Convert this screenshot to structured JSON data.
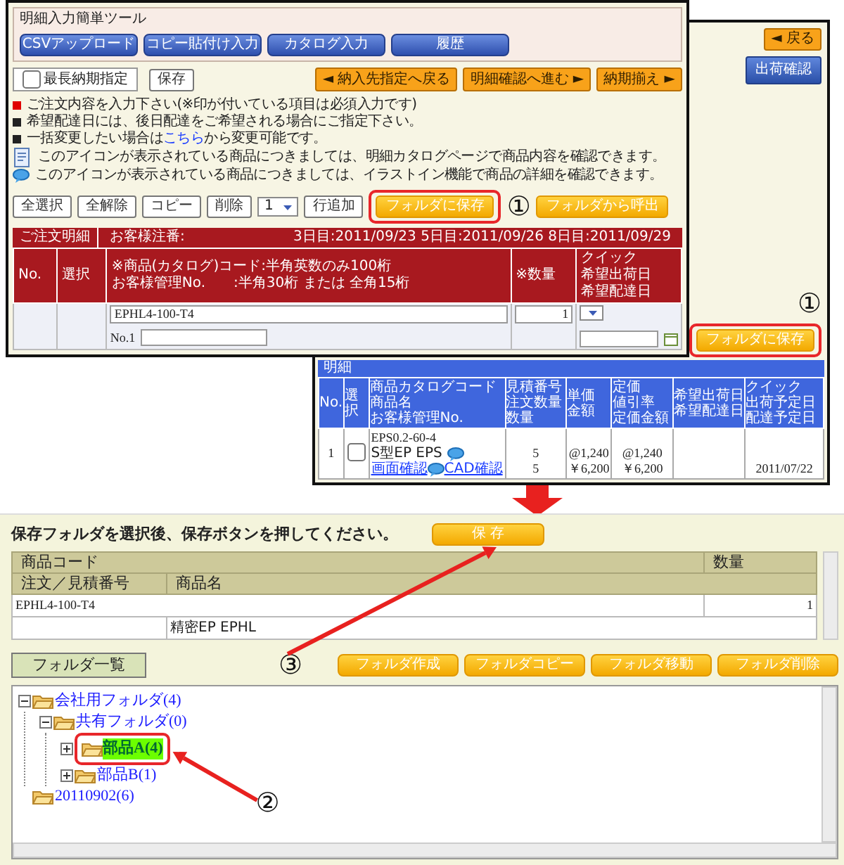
{
  "order_entry_screen": {
    "title": "明細入力簡単ツール",
    "tool_buttons": [
      "CSVアップロード",
      "コピー貼付け入力",
      "カタログ入力",
      "履歴"
    ],
    "nav_buttons": [
      "◄ 納入先指定へ戻る",
      "明細確認へ進む ►"
    ],
    "deadline_button": "納期揃え ►",
    "notes": [
      {
        "kind": "required",
        "text": "ご注文内容を入力下さい(※印が付いている項目は必須入力です)"
      },
      {
        "kind": "bullet",
        "text": "希望配達日には、後日配達をご希望される場合にご指定下さい。"
      },
      {
        "kind": "bullet",
        "text": "一括変更したい場合は",
        "link": "こちら",
        "after": "から変更可能です。"
      },
      {
        "kind": "catalog_icon",
        "text": "このアイコンが表示されている商品につきましては、明細カタログページで商品内容を確認できます。"
      },
      {
        "kind": "illust_icon",
        "text": "このアイコンが表示されている商品につきましては、イラストイン機能で商品の詳細を確認できます。"
      }
    ],
    "row_buttons": [
      "全選択",
      "全解除",
      "コピー",
      "削除"
    ],
    "row_count": "1",
    "add_row_button": "行追加",
    "folder_buttons": [
      {
        "label": "フォルダに保存",
        "callout": "①"
      },
      {
        "label": "フォルダから呼出"
      }
    ],
    "longest_deadline": {
      "label": "最長納期指定",
      "checked": false
    },
    "save_button": "保存",
    "header_bar": {
      "title": "ご注文明細",
      "customer_order_label": "お客様注番:",
      "dates": "3日目:2011/09/23 5日目:2011/09/26 8日目:2011/09/29"
    },
    "columns": [
      {
        "lines": [
          "No."
        ]
      },
      {
        "lines": [
          "選択"
        ]
      },
      {
        "lines": [
          "※商品(カタログ)コード:半角英数のみ100桁",
          "お客様管理No.　　:半角30桁 または 全角15桁"
        ]
      },
      {
        "lines": [
          "※数量"
        ]
      },
      {
        "lines": [
          "クイック",
          "希望出荷日",
          "希望配達日"
        ]
      }
    ],
    "rows": [
      {
        "code": "EPHL4-100-T4",
        "no_label": "No.1",
        "quantity": "1"
      }
    ]
  },
  "confirm_screen": {
    "back_button": "◄ 戻る",
    "ship_check_button": "出荷確認",
    "folder_button": {
      "label": "フォルダに保存",
      "callout": "①"
    },
    "section_title": "明細",
    "columns": [
      {
        "lines": [
          "No."
        ]
      },
      {
        "lines": [
          "選択"
        ]
      },
      {
        "lines": [
          "商品カタログコード",
          "商品名",
          "お客様管理No."
        ]
      },
      {
        "lines": [
          "見積番号",
          "注文数量",
          "数量"
        ]
      },
      {
        "lines": [
          "単価",
          "金額"
        ]
      },
      {
        "lines": [
          "定価",
          "値引率",
          "定価金額"
        ]
      },
      {
        "lines": [
          "希望出荷日",
          "希望配達日"
        ]
      },
      {
        "lines": [
          "クイック",
          "出荷予定日",
          "配達予定日"
        ]
      }
    ],
    "rows": [
      {
        "no": "1",
        "selected": false,
        "code": "EPS0.2-60-4",
        "name": "S型EP EPS",
        "links": [
          "画面確認",
          "CAD確認"
        ],
        "quantities": [
          "5",
          "5"
        ],
        "unit_price": [
          "@1,240",
          "￥6,200"
        ],
        "list_price": [
          "@1,240",
          "￥6,200"
        ],
        "quick_date": "2011/07/22"
      }
    ]
  },
  "save_dialog": {
    "instruction": "保存フォルダを選択後、保存ボタンを押してください。",
    "save_button": "保 存",
    "save_callout": "③",
    "header_row_1": [
      "商品コード",
      "数量"
    ],
    "header_row_2": [
      "注文／見積番号",
      "商品名"
    ],
    "rows": [
      {
        "code": "EPHL4-100-T4",
        "quantity": "1",
        "name": "精密EP EPHL"
      }
    ],
    "folder_list_label": "フォルダ一覧",
    "folder_buttons": [
      "フォルダ作成",
      "フォルダコピー",
      "フォルダ移動",
      "フォルダ削除"
    ],
    "tree": [
      {
        "label": "会社用フォルダ(4)",
        "expanded": true,
        "selected": false,
        "children": [
          {
            "label": "共有フォルダ(0)",
            "expanded": true,
            "selected": false,
            "children": [
              {
                "label": "部品A(4)",
                "expanded": false,
                "selected": true,
                "callout": "②"
              },
              {
                "label": "部品B(1)",
                "expanded": false,
                "selected": false
              }
            ]
          }
        ]
      },
      {
        "label": "20110902(6)",
        "selected": false
      }
    ]
  }
}
